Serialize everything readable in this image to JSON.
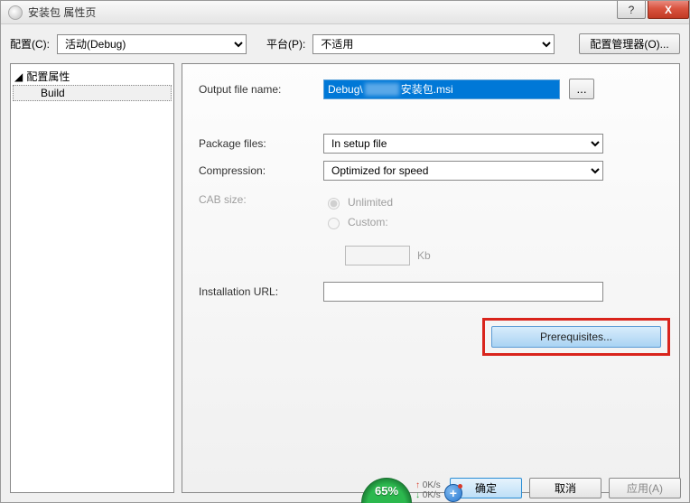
{
  "window": {
    "title": "安装包 属性页"
  },
  "winbuttons": {
    "help": "?",
    "close": "X"
  },
  "toolbar": {
    "config_label": "配置(C):",
    "config_value": "活动(Debug)",
    "platform_label": "平台(P):",
    "platform_value": "不适用",
    "configmgr_label": "配置管理器(O)..."
  },
  "tree": {
    "root_label": "配置属性",
    "child_label": "Build"
  },
  "form": {
    "output_label": "Output file name:",
    "output_value_prefix": "Debug\\",
    "output_value_suffix": "安装包.msi",
    "browse_label": "...",
    "package_label": "Package files:",
    "package_value": "In setup file",
    "compression_label": "Compression:",
    "compression_value": "Optimized for speed",
    "cab_label": "CAB size:",
    "cab_unlimited": "Unlimited",
    "cab_custom": "Custom:",
    "kb_unit": "Kb",
    "install_url_label": "Installation URL:",
    "prereq_label": "Prerequisites..."
  },
  "footer": {
    "ok": "确定",
    "cancel": "取消",
    "apply": "应用(A)"
  },
  "netwidget": {
    "percent": "65%",
    "up": "0K/s",
    "down": "0K/s"
  }
}
